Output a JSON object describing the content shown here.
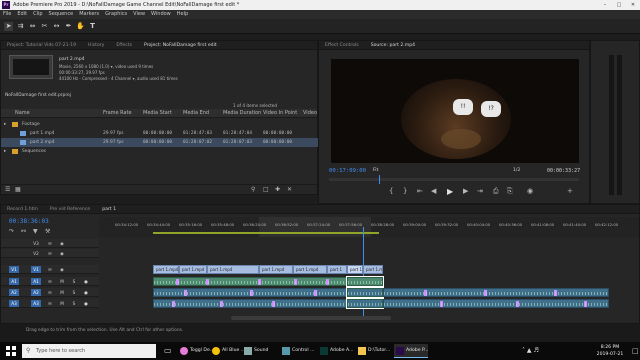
{
  "window": {
    "title": "Adobe Premiere Pro 2019 - D:\\NoFallDamage Game Channel Edit\\NoFallDamage first edit *",
    "logo": "Pr"
  },
  "menu": [
    "File",
    "Edit",
    "Clip",
    "Sequence",
    "Markers",
    "Graphics",
    "View",
    "Window",
    "Help"
  ],
  "tools": [
    "selection-tool",
    "track-select-tool",
    "ripple-edit-tool",
    "razor-tool",
    "slip-tool",
    "pen-tool",
    "hand-tool",
    "type-tool"
  ],
  "project_panel": {
    "tabs": [
      "Project: Tutorial Vids 07-21-19",
      "History",
      "Effects",
      "Project: NoFallDamage first edit"
    ],
    "clip_name": "part 2.mp4",
    "clip_info": [
      "Movie, 2560 x 1080 (1.0)  ▾, video used 9 times",
      "00:00:33:27, 29.97 fps",
      "44100 Hz - Compressed - 4 Channel  ▾, audio used 81 times"
    ],
    "project_file": "NoFallDamage first edit.prproj",
    "items_count": "1 of 4 items selected",
    "columns": [
      "Name",
      "Frame Rate",
      "Media Start",
      "Media End",
      "Media Duration",
      "Video In Point",
      "Video"
    ],
    "rows": [
      {
        "name": "Footage",
        "fps": "",
        "start": "",
        "end": "",
        "dur": "",
        "vin": "",
        "folder": true,
        "indent": 0
      },
      {
        "name": "part 1.mp4",
        "fps": "29.97 fps",
        "start": "00:00:00:00",
        "end": "01:28:47:03",
        "dur": "01:28:47:04",
        "vin": "00:00:00:00",
        "folder": false,
        "indent": 1
      },
      {
        "name": "part 2.mp4",
        "fps": "29.97 fps",
        "start": "00:00:00:00",
        "end": "01:28:07:02",
        "dur": "01:28:07:03",
        "vin": "00:00:00:00",
        "folder": false,
        "indent": 1
      },
      {
        "name": "Sequences",
        "fps": "",
        "start": "",
        "end": "",
        "dur": "",
        "vin": "",
        "folder": true,
        "indent": 0
      }
    ]
  },
  "source_panel": {
    "tabs": [
      "Effect Controls",
      "Source: part 2.mp4"
    ],
    "timecode": "00:17:09:00",
    "fit": "Fit",
    "ratio": "1/2",
    "duration": "00:00:33:27",
    "speech_signs": [
      "!!",
      "!?"
    ]
  },
  "timeline": {
    "tabs": [
      "Record 1.htm",
      "Pre vid Reference",
      "part 1"
    ],
    "timecode": "00:38:36:03",
    "ruler": [
      "00:34:12:00",
      "00:34:44:00",
      "00:35:16:00",
      "00:35:48:00",
      "00:36:20:00",
      "00:36:52:00",
      "00:37:24:00",
      "00:37:56:00",
      "00:38:28:00",
      "00:39:00:00",
      "00:39:32:00",
      "00:40:04:00",
      "00:40:36:00",
      "00:41:08:00",
      "00:41:40:00",
      "00:42:12:00"
    ],
    "tracks": [
      "V3",
      "V2",
      "V1",
      "A1",
      "A2",
      "A3"
    ],
    "video_clips": [
      "part 1.mp4",
      "part 1.mp4",
      "part 1.mp4",
      "part 1.mp4",
      "part 1.mp4",
      "part 1",
      "part 1",
      "part 1.mp4"
    ]
  },
  "status_bar": "Drag edge to trim from the selection. Use Alt and Ctrl for other options.",
  "taskbar": {
    "search_placeholder": "Type here to search",
    "apps": [
      "Toggl De...",
      "All Blue ...",
      "Sound",
      "Control ...",
      "Adobe A...",
      "D:\\Tutor...",
      "Adobe P..."
    ],
    "time": "8:26 PM",
    "date": "2019-07-21"
  },
  "colors": {
    "accent": "#3f8ef2",
    "premiere_purple": "#2a0a4a",
    "video_clip": "#a6bce0",
    "audio_clip": "#4d8a6f"
  }
}
